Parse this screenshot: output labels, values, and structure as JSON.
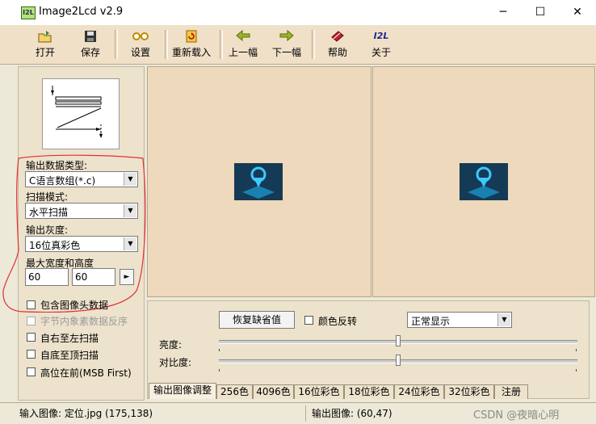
{
  "window": {
    "icon_text": "I2L",
    "title": "Image2Lcd v2.9",
    "controls": {
      "minimize": "─",
      "maximize": "☐",
      "close": "✕"
    }
  },
  "toolbar": {
    "open": "打开",
    "save": "保存",
    "settings": "设置",
    "reload": "重新载入",
    "prev": "上一幅",
    "next": "下一幅",
    "help": "帮助",
    "about": "关于",
    "about_icon_text": "I2L"
  },
  "left_panel": {
    "output_type_label": "输出数据类型:",
    "output_type_value": "C语言数组(*.c)",
    "scan_mode_label": "扫描模式:",
    "scan_mode_value": "水平扫描",
    "gray_label": "输出灰度:",
    "gray_value": "16位真彩色",
    "max_size_label": "最大宽度和高度",
    "max_width": "60",
    "max_height": "60",
    "apply_arrow": "►",
    "checkboxes": [
      {
        "label": "包含图像头数据",
        "checked": false,
        "enabled": true
      },
      {
        "label": "字节内象素数据反序",
        "checked": false,
        "enabled": false
      },
      {
        "label": "自右至左扫描",
        "checked": false,
        "enabled": true
      },
      {
        "label": "自底至顶扫描",
        "checked": false,
        "enabled": true
      },
      {
        "label": "高位在前(MSB First)",
        "checked": false,
        "enabled": true
      }
    ]
  },
  "controls": {
    "restore_defaults": "恢复缺省值",
    "invert_colors": "颜色反转",
    "display_mode": "正常显示",
    "brightness_label": "亮度:",
    "contrast_label": "对比度:",
    "brightness_level": 0.5,
    "contrast_level": 0.5
  },
  "tabs": [
    "输出图像调整",
    "256色",
    "4096色",
    "16位彩色",
    "18位彩色",
    "24位彩色",
    "32位彩色",
    "注册"
  ],
  "status": {
    "input": "输入图像: 定位.jpg (175,138)",
    "output": "输出图像: (60,47)"
  },
  "watermark": "CSDN @夜暗心明",
  "colors": {
    "annotation": "#e0303a",
    "pane_bg": "#eed9bc",
    "toolbar_bg": "#f0e0c8"
  }
}
